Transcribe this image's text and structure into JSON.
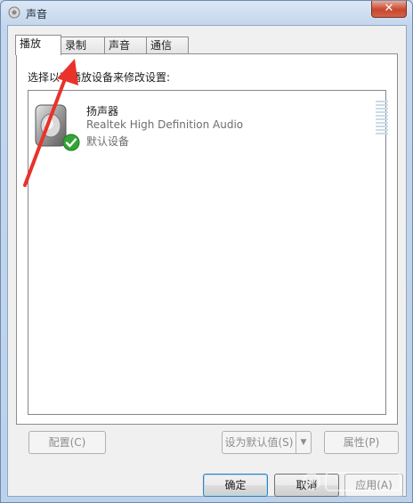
{
  "window": {
    "title": "声音",
    "close_label": "✕"
  },
  "tabs": [
    {
      "label": "播放"
    },
    {
      "label": "录制"
    },
    {
      "label": "声音"
    },
    {
      "label": "通信"
    }
  ],
  "panel": {
    "instruction": "选择以下播放设备来修改设置:"
  },
  "devices": [
    {
      "name": "扬声器",
      "description": "Realtek High Definition Audio",
      "status": "默认设备"
    }
  ],
  "buttons": {
    "configure": "配置(C)",
    "set_default": "设为默认值(S)",
    "properties": "属性(P)",
    "ok": "确定",
    "cancel": "取消",
    "apply": "应用(A)"
  },
  "icons": {
    "title": "speaker-icon",
    "device": "speaker-icon",
    "status": "checkmark-icon"
  },
  "colors": {
    "annotation_arrow": "#e8322a",
    "check_green": "#33a536"
  }
}
